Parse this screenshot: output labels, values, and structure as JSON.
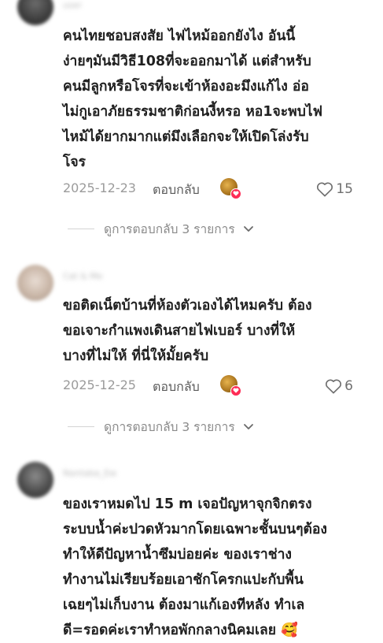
{
  "comments": [
    {
      "username": "user",
      "lines": [
        "คนไทยชอบสงสัย ไฟไหม้ออกยังไง อันนี้",
        "ง่ายๆมันมีวิธี108ที่จะออกมาได้ แต่สำหรับ",
        "คนมีลูกหรือโจรที่จะเข้าห้องอะมึงแก้ไง อ่อ",
        "ไม่กูเอาภัยธรรมชาติก่อนงี้หรอ หอ1จะพบไฟ",
        "ไหม้ได้ยากมากแต่มึงเลือกจะให้เปิดโล่งรับ",
        "โจร"
      ],
      "date": "2025-12-23",
      "reply_label": "ตอบกลับ",
      "likes": "15",
      "view_replies": "ดูการตอบกลับ 3 รายการ"
    },
    {
      "username": "Cat & Me",
      "lines": [
        "ขอติดเน็ตบ้านที่ห้องตัวเองได้ไหมครับ ต้อง",
        "ขอเจาะกำแพงเดินสายไฟเบอร์ บางที่ให้",
        "บางที่ไม่ให้ ที่นี่ให้มั้ยครับ"
      ],
      "date": "2025-12-25",
      "reply_label": "ตอบกลับ",
      "likes": "6",
      "view_replies": "ดูการตอบกลับ 3 รายการ"
    },
    {
      "username": "Nantaba_Ew",
      "lines": [
        "ของเราหมดไป 15 m เจอปัญหาจุกจิกตรง",
        "ระบบน้ำค่ะปวดหัวมากโดยเฉพาะชั้นบนๆต้อง",
        "ทำให้ดีปัญหาน้ำซึมบ่อยค่ะ ของเราช่าง",
        "ทำงานไม่เรียบร้อยเอาชักโครกแปะกับพื้น",
        "เฉยๆไม่เก็บงาน ต้องมาแก้เองทีหลัง ทำเล",
        "ดี=รอดค่ะเราทำหอพักกลางนิคมเลย 🥰"
      ]
    }
  ],
  "colors": {
    "heart_badge": "#fe2c55",
    "text": "#202020",
    "muted": "#9b9b9b"
  }
}
